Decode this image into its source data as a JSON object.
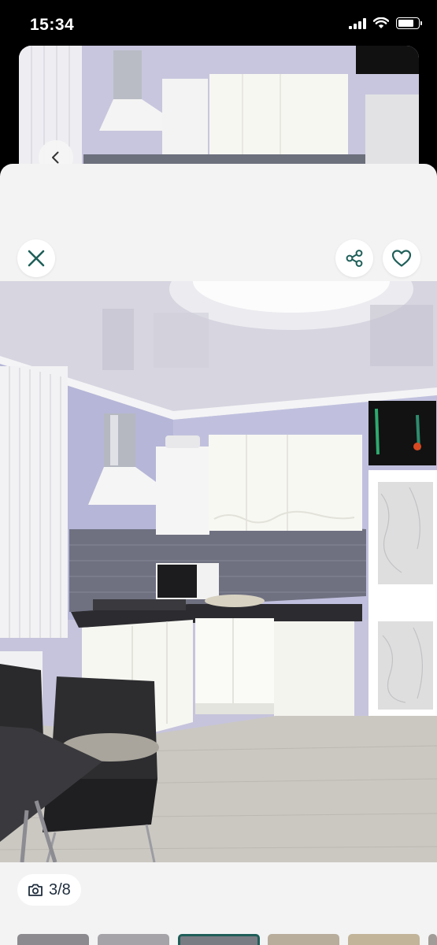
{
  "status_bar": {
    "time": "15:34",
    "battery_level": 0.8
  },
  "gallery": {
    "counter": "3/8"
  },
  "icons": {
    "back": "chevron-left-icon",
    "close": "close-icon",
    "share": "share-icon",
    "favorite": "heart-icon",
    "camera": "camera-icon"
  },
  "colors": {
    "accent": "#1f5f59",
    "sheet_bg": "#f3f3f3"
  }
}
